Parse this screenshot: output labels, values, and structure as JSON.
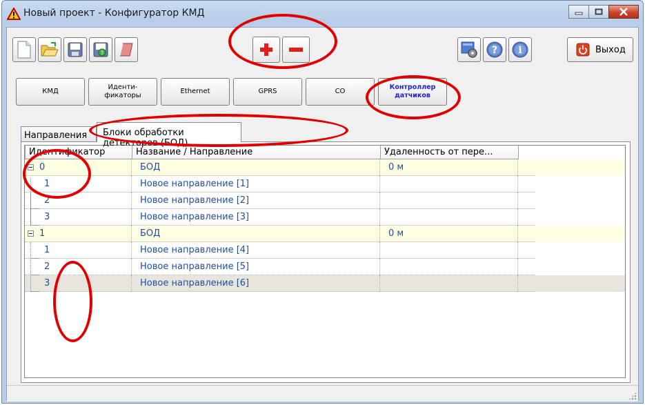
{
  "window": {
    "title": "Новый проект - Конфигуратор КМД"
  },
  "toolbar": {
    "icons": [
      "new-file-icon",
      "open-folder-icon",
      "save-icon",
      "save-as-icon",
      "eraser-icon"
    ],
    "add_label": "+",
    "remove_label": "−",
    "exit_label": "Выход"
  },
  "nav": [
    {
      "label": "КМД"
    },
    {
      "label": "Иденти-\nфикаторы"
    },
    {
      "label": "Ethernet"
    },
    {
      "label": "GPRS"
    },
    {
      "label": "СО"
    },
    {
      "label": "Контроллер\nдатчиков"
    }
  ],
  "tabs": {
    "t1": "Направления",
    "t2": "Блоки обработки детекторов (БОД)"
  },
  "grid": {
    "columns": [
      "Идентификатор",
      "Название / Направление",
      "Удаленность от пере..."
    ],
    "rows": [
      {
        "id": "0",
        "name": "БОД",
        "distance": "0 м"
      },
      {
        "id": "1",
        "name": "Новое направление [1]",
        "distance": ""
      },
      {
        "id": "2",
        "name": "Новое направление [2]",
        "distance": ""
      },
      {
        "id": "3",
        "name": "Новое направление [3]",
        "distance": ""
      },
      {
        "id": "1",
        "name": "БОД",
        "distance": "0 м"
      },
      {
        "id": "1",
        "name": "Новое направление [4]",
        "distance": ""
      },
      {
        "id": "2",
        "name": "Новое направление [5]",
        "distance": ""
      },
      {
        "id": "3",
        "name": "Новое направление [6]",
        "distance": ""
      }
    ]
  },
  "colors": {
    "annotation": "#e00000",
    "link_text": "#1f4fa0",
    "parent_row": "#fefee3",
    "selected_row": "#e8e5de"
  }
}
